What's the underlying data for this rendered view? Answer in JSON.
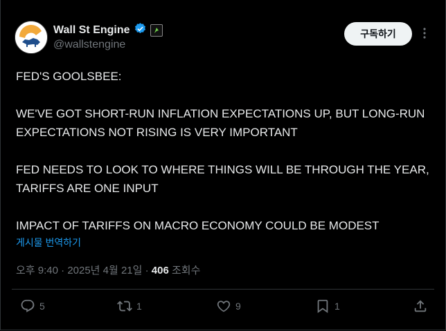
{
  "author": {
    "name": "Wall St Engine",
    "handle": "@wallstengine"
  },
  "subscribe_label": "구독하기",
  "post": {
    "lines": [
      "FED'S GOOLSBEE:",
      "WE'VE GOT SHORT-RUN INFLATION EXPECTATIONS UP, BUT LONG-RUN EXPECTATIONS NOT RISING IS VERY IMPORTANT",
      "FED NEEDS TO LOOK TO WHERE THINGS WILL BE THROUGH THE YEAR, TARIFFS ARE ONE INPUT",
      "IMPACT OF TARIFFS ON MACRO ECONOMY COULD BE MODEST"
    ],
    "translate_label": "게시물 번역하기"
  },
  "meta": {
    "time": "오후 9:40",
    "date": "2025년 4월 21일",
    "views_count": "406",
    "views_label": "조회수"
  },
  "actions": {
    "replies": "5",
    "reposts": "1",
    "likes": "9",
    "bookmarks": "1"
  },
  "colors": {
    "accent": "#1d9bf0",
    "verified": "#1d9bf0",
    "muted": "#71767b",
    "background": "#000000"
  },
  "icons": [
    "verified-badge-icon",
    "affiliate-badge-icon",
    "more-icon",
    "reply-icon",
    "repost-icon",
    "like-icon",
    "bookmark-icon",
    "share-icon"
  ]
}
